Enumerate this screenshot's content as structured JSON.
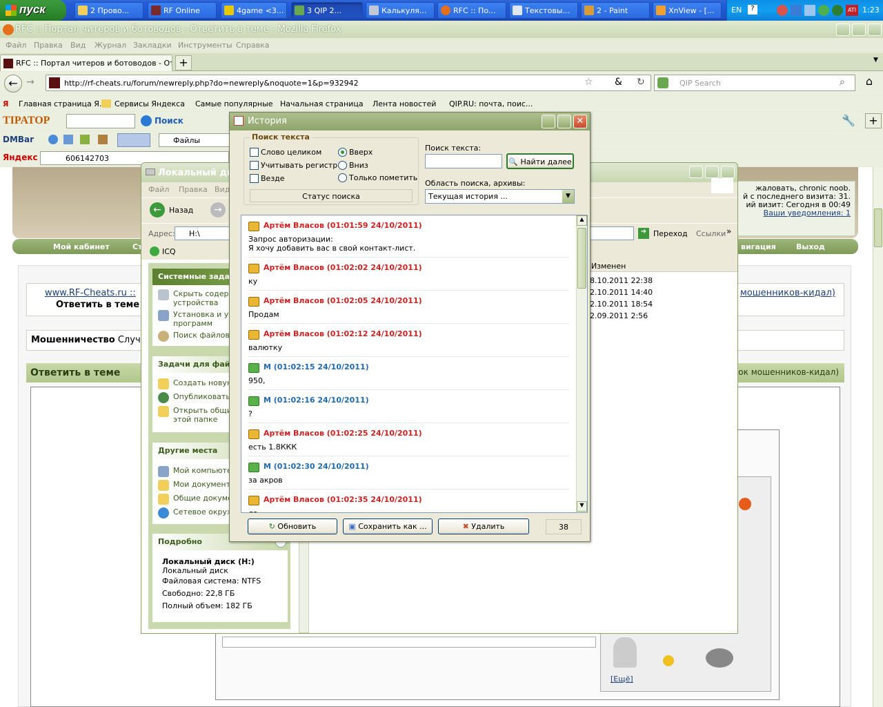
{
  "taskbar": {
    "start": "пуск",
    "tasks": [
      "2 Прово...",
      "RF Online",
      "4game <3...",
      "3 QIP 2...",
      "Калькуля...",
      "RFC :: По...",
      "Текстовы...",
      "2 - Paint",
      "XnView - [..."
    ],
    "lang": "EN",
    "clock": "1:23"
  },
  "firefox": {
    "title": "RFC :: Портал читеров и ботоводов - Ответить в теме - Mozilla Firefox",
    "menu": [
      "Файл",
      "Правка",
      "Вид",
      "Журнал",
      "Закладки",
      "Инструменты",
      "Справка"
    ],
    "tab_title": "RFC :: Портал читеров и ботоводов - Отв...",
    "url": "http://rf-cheats.ru/forum/newreply.php?do=newreply&noquote=1&p=932942",
    "search_placeholder": "QIP Search",
    "bookmarks": [
      "Главная страница Я...",
      "Сервисы Яндекса",
      "Самые популярные",
      "Начальная страница",
      "Лента новостей",
      "QIP.RU: почта, поис..."
    ],
    "tirator": {
      "logo": "TIPATOP",
      "search": "Поиск"
    },
    "dmbar": {
      "logo": "DMBar",
      "files": "Файлы"
    },
    "yandex": {
      "logo": "Яндекс",
      "value": "606142703"
    }
  },
  "webpage": {
    "welcome": "жаловать, chronic noob.",
    "last_visit": "й с последнего визита: 31.",
    "visit": "ий визит: Сегодня в 00:49",
    "notifications": "Ваши уведомления: 1",
    "nav": [
      "Мой кабинет",
      "Ст",
      "вигация",
      "Выход"
    ],
    "breadcrumb_site": "www.RF-Cheats.ru ::",
    "breadcrumb_page": "Ответить в теме",
    "breadcrumb_right": "мошенников-кидал)",
    "section_title": "Мошенничество",
    "section_sub": "Случа",
    "reply_title": "Ответить в теме",
    "reply_right": "исок мошенников-кидал)",
    "more_link": "[Ещё]"
  },
  "explorer": {
    "title": "Локальный диск",
    "menu": [
      "Файл",
      "Правка",
      "Вид"
    ],
    "back": "Назад",
    "address_label": "Адрес:",
    "address": "H:\\",
    "go": "Переход",
    "links": "Ссылки",
    "icq": "ICQ",
    "column_modified": "Изменен",
    "dates": [
      "8.10.2011 22:38",
      "2.10.2011 14:40",
      "2.10.2011 18:54",
      "2.09.2011 2:56"
    ],
    "system_tasks": {
      "title": "Системные задач",
      "items": [
        "Скрыть содерж",
        "устройства",
        "Установка и уд",
        "программ",
        "Поиск файлов и"
      ]
    },
    "file_tasks": {
      "title": "Задачи для файл",
      "items": [
        "Создать новую",
        "Опубликовать",
        "Открыть общий",
        "этой папке"
      ]
    },
    "other_places": {
      "title": "Другие места",
      "items": [
        "Мой компьютер",
        "Мои документы",
        "Общие докумен",
        "Сетевое окруж"
      ]
    },
    "details": {
      "title": "Подробно",
      "name": "Локальный диск (H:)",
      "type": "Локальный диск",
      "fs": "Файловая система: NTFS",
      "free": "Свободно: 22,8 ГБ",
      "total": "Полный объем: 182 ГБ"
    }
  },
  "history": {
    "title": "История",
    "search_group": "Поиск текста",
    "whole_word": "Слово целиком",
    "case": "Учитывать регистр",
    "everywhere": "Везде",
    "up": "Вверх",
    "down": "Вниз",
    "mark_only": "Только пометить",
    "status": "Статус поиска",
    "search_label": "Поиск текста:",
    "find_next": "Найти далее",
    "area_label": "Область поиска, архивы:",
    "area_value": "Текущая история ...",
    "messages": [
      {
        "type": "in",
        "head": "Артём Власов (01:01:59 24/10/2011)",
        "body1": "Запрос авторизации:",
        "body2": "Я хочу добавить вас в свой контакт-лист."
      },
      {
        "type": "in",
        "head": "Артём Власов (01:02:02 24/10/2011)",
        "body1": "ку"
      },
      {
        "type": "in",
        "head": "Артём Власов (01:02:05 24/10/2011)",
        "body1": "Продам"
      },
      {
        "type": "in",
        "head": "Артём Власов (01:02:12 24/10/2011)",
        "body1": "валютку"
      },
      {
        "type": "out",
        "head": "М (01:02:15 24/10/2011)",
        "body1": "950,"
      },
      {
        "type": "out",
        "head": "М (01:02:16 24/10/2011)",
        "body1": "?"
      },
      {
        "type": "in",
        "head": "Артём Власов (01:02:25 24/10/2011)",
        "body1": "есть 1.8ККК"
      },
      {
        "type": "out",
        "head": "М (01:02:30 24/10/2011)",
        "body1": "за акров"
      },
      {
        "type": "in",
        "head": "Артём Власов (01:02:35 24/10/2011)",
        "body1": "ла"
      }
    ],
    "refresh": "Обновить",
    "save_as": "Сохранить как ...",
    "delete": "Удалить",
    "count": "38"
  }
}
